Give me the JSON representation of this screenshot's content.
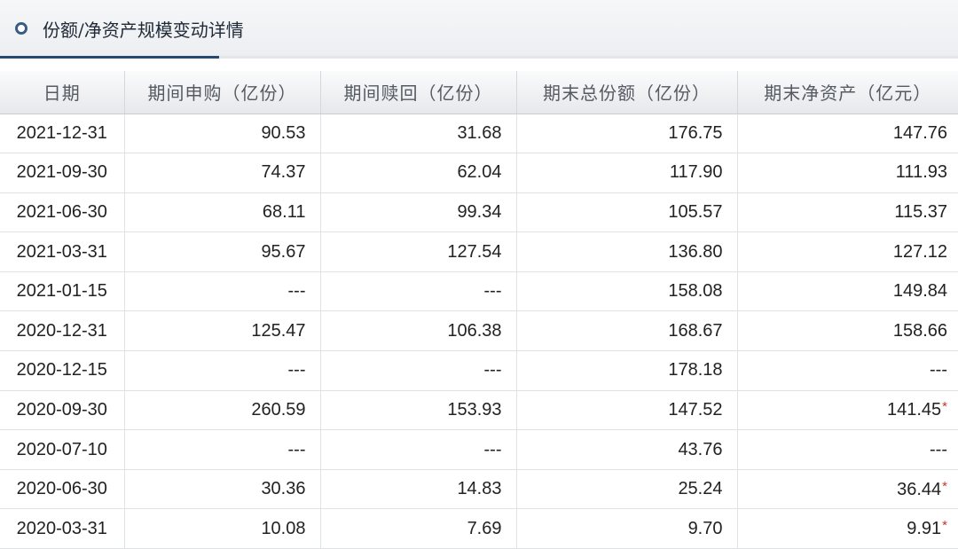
{
  "panel": {
    "title": "份额/净资产规模变动详情",
    "title_icon": "ring-bullet-icon",
    "accent_color": "#274a70"
  },
  "table": {
    "columns": [
      "日期",
      "期间申购（亿份）",
      "期间赎回（亿份）",
      "期末总份额（亿份）",
      "期末净资产（亿元）"
    ],
    "footnote_marker": "*",
    "footnote_marker_color": "#c0392b",
    "rows": [
      {
        "date": "2021-12-31",
        "subscription": "90.53",
        "redemption": "31.68",
        "total_shares": "176.75",
        "net_assets": "147.76",
        "net_assets_marked": false
      },
      {
        "date": "2021-09-30",
        "subscription": "74.37",
        "redemption": "62.04",
        "total_shares": "117.90",
        "net_assets": "111.93",
        "net_assets_marked": false
      },
      {
        "date": "2021-06-30",
        "subscription": "68.11",
        "redemption": "99.34",
        "total_shares": "105.57",
        "net_assets": "115.37",
        "net_assets_marked": false
      },
      {
        "date": "2021-03-31",
        "subscription": "95.67",
        "redemption": "127.54",
        "total_shares": "136.80",
        "net_assets": "127.12",
        "net_assets_marked": false
      },
      {
        "date": "2021-01-15",
        "subscription": "---",
        "redemption": "---",
        "total_shares": "158.08",
        "net_assets": "149.84",
        "net_assets_marked": false
      },
      {
        "date": "2020-12-31",
        "subscription": "125.47",
        "redemption": "106.38",
        "total_shares": "168.67",
        "net_assets": "158.66",
        "net_assets_marked": false
      },
      {
        "date": "2020-12-15",
        "subscription": "---",
        "redemption": "---",
        "total_shares": "178.18",
        "net_assets": "---",
        "net_assets_marked": false
      },
      {
        "date": "2020-09-30",
        "subscription": "260.59",
        "redemption": "153.93",
        "total_shares": "147.52",
        "net_assets": "141.45",
        "net_assets_marked": true
      },
      {
        "date": "2020-07-10",
        "subscription": "---",
        "redemption": "---",
        "total_shares": "43.76",
        "net_assets": "---",
        "net_assets_marked": false
      },
      {
        "date": "2020-06-30",
        "subscription": "30.36",
        "redemption": "14.83",
        "total_shares": "25.24",
        "net_assets": "36.44",
        "net_assets_marked": true
      },
      {
        "date": "2020-03-31",
        "subscription": "10.08",
        "redemption": "7.69",
        "total_shares": "9.70",
        "net_assets": "9.91",
        "net_assets_marked": true
      }
    ]
  }
}
